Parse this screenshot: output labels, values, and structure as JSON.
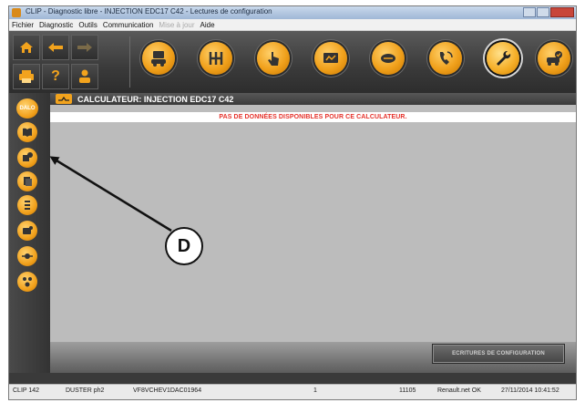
{
  "window": {
    "title": "CLIP - Diagnostic libre - INJECTION EDC17 C42 - Lectures de configuration"
  },
  "menu": {
    "items": [
      {
        "label": "Fichier",
        "enabled": true
      },
      {
        "label": "Diagnostic",
        "enabled": true
      },
      {
        "label": "Outils",
        "enabled": true
      },
      {
        "label": "Communication",
        "enabled": true
      },
      {
        "label": "Mise à jour",
        "enabled": false
      },
      {
        "label": "Aide",
        "enabled": true
      }
    ]
  },
  "nav": {
    "help_label": "?"
  },
  "toolbar": {
    "icons": [
      "vehicle-id-icon",
      "gearbox-icon",
      "touch-icon",
      "screen-icon",
      "wiring-icon",
      "phone-support-icon",
      "wrench-icon",
      "car-check-icon"
    ],
    "active": "wrench-icon"
  },
  "sidebar": {
    "dalo_label": "DALO"
  },
  "header": {
    "title": "CALCULATEUR: INJECTION EDC17 C42"
  },
  "message": {
    "text": "PAS DE DONNÉES DISPONIBLES POUR CE CALCULATEUR."
  },
  "action": {
    "ecritures_label": "ECRITURES DE CONFIGURATION"
  },
  "status": {
    "clip": "CLIP 142",
    "vehicle": "DUSTER ph2",
    "vin": "VF8VCHEV1DAC01964",
    "count": "1",
    "code": "11105",
    "network": "Renault.net OK",
    "datetime": "27/11/2014 10:41:52"
  },
  "annotation": {
    "label": "D"
  },
  "colors": {
    "accent": "#f2a31d",
    "error": "#e5322b",
    "chrome": "#3a3a3a"
  }
}
